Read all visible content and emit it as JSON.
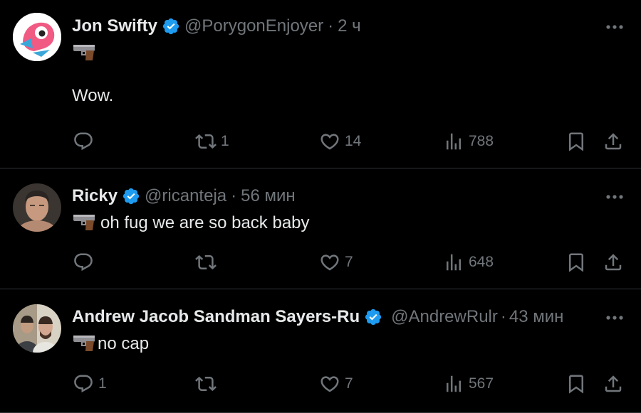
{
  "tweets": [
    {
      "name": "Jon Swifty",
      "handle": "@PorygonEnjoyer",
      "separator": "·",
      "time": "2 ч",
      "lines": [
        "Wow."
      ],
      "replies": "",
      "retweets": "1",
      "likes": "14",
      "views": "788",
      "avatar": "porygon"
    },
    {
      "name": "Ricky",
      "handle": "@ricanteja",
      "separator": "·",
      "time": "56 мин",
      "lines": [
        "oh fug we are so back baby"
      ],
      "replies": "",
      "retweets": "",
      "likes": "7",
      "views": "648",
      "avatar": "person"
    },
    {
      "name": "Andrew Jacob Sandman Sayers-Ru",
      "handle": "@AndrewRulr",
      "separator": "·",
      "time": "43 мин",
      "lines": [
        "no cap"
      ],
      "replies": "1",
      "retweets": "",
      "likes": "7",
      "views": "567",
      "avatar": "photo"
    }
  ],
  "icons": {
    "verified": "verified-badge-icon",
    "more": "more-options-icon",
    "reply": "reply-icon",
    "retweet": "retweet-icon",
    "like": "like-icon",
    "views": "views-icon",
    "bookmark": "bookmark-icon",
    "share": "share-icon",
    "emoji": "pistol-emoji"
  },
  "colors": {
    "background": "#000000",
    "text": "#e7e9ea",
    "muted": "#71767b",
    "verified": "#1d9bf0",
    "divider": "#2f3336"
  }
}
